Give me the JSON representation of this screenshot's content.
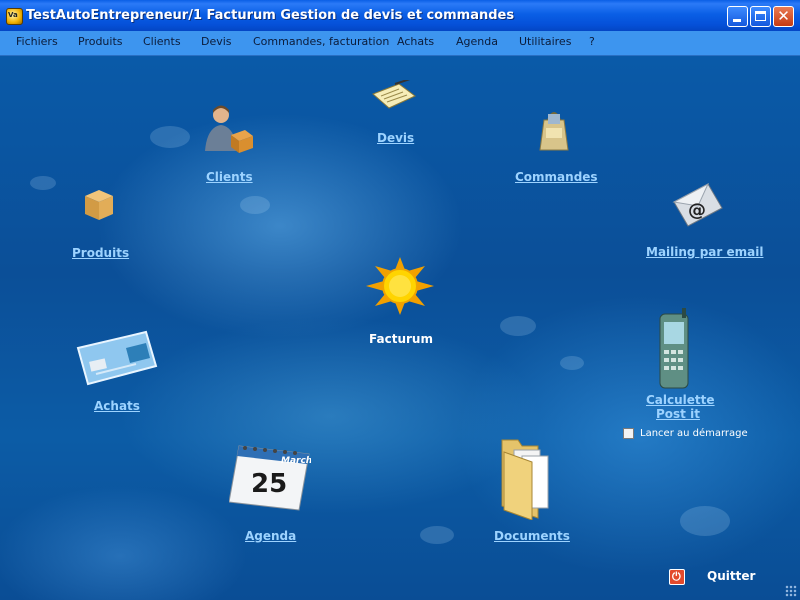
{
  "window": {
    "title": "TestAutoEntrepreneur/1 Facturum Gestion de devis et commandes",
    "app_icon_text": "Va"
  },
  "menu": {
    "items": [
      "Fichiers",
      "Produits",
      "Clients",
      "Devis",
      "Commandes, facturation",
      "Achats",
      "Agenda",
      "Utilitaires",
      "?"
    ]
  },
  "desktop": {
    "devis": "Devis",
    "clients": "Clients",
    "commandes": "Commandes",
    "produits": "Produits",
    "mailing": "Mailing par email",
    "center": "Facturum",
    "achats": "Achats",
    "calculette": "Calculette",
    "postit": "Post it",
    "lancer": "Lancer au démarrage",
    "agenda": "Agenda",
    "agenda_month": "March",
    "agenda_day": "25",
    "documents": "Documents",
    "quitter": "Quitter"
  },
  "colors": {
    "title_bar": "#0a5fe6",
    "menu_bar": "#3d95ef",
    "desktop": "#0b4f98",
    "link": "#9dd3ff"
  }
}
